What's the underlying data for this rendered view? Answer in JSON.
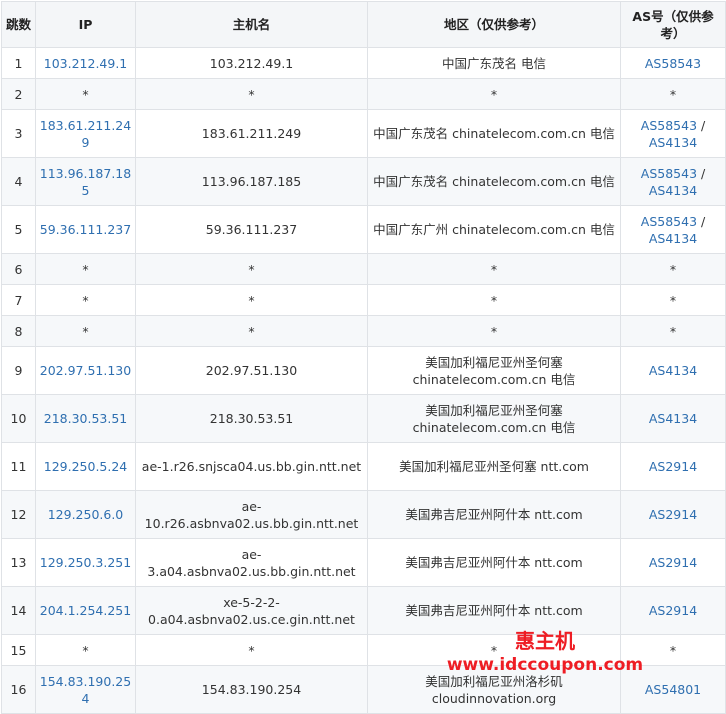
{
  "headers": {
    "hop": "跳数",
    "ip": "IP",
    "hostname": "主机名",
    "region": "地区（仅供参考）",
    "as": "AS号（仅供参考）"
  },
  "rows": [
    {
      "hop": "1",
      "ip": "103.212.49.1",
      "host": "103.212.49.1",
      "region": "中国广东茂名 电信",
      "as": "AS58543"
    },
    {
      "hop": "2",
      "ip": "*",
      "host": "*",
      "region": "*",
      "as": "*"
    },
    {
      "hop": "3",
      "ip": "183.61.211.249",
      "host": "183.61.211.249",
      "region": "中国广东茂名 chinatelecom.com.cn 电信",
      "as": "AS58543",
      "as_sep": " / ",
      "as2": "AS4134"
    },
    {
      "hop": "4",
      "ip": "113.96.187.185",
      "host": "113.96.187.185",
      "region": "中国广东茂名 chinatelecom.com.cn 电信",
      "as": "AS58543",
      "as_sep": " / ",
      "as2": "AS4134"
    },
    {
      "hop": "5",
      "ip": "59.36.111.237",
      "host": "59.36.111.237",
      "region": "中国广东广州 chinatelecom.com.cn 电信",
      "as": "AS58543",
      "as_sep": " / ",
      "as2": "AS4134"
    },
    {
      "hop": "6",
      "ip": "*",
      "host": "*",
      "region": "*",
      "as": "*"
    },
    {
      "hop": "7",
      "ip": "*",
      "host": "*",
      "region": "*",
      "as": "*"
    },
    {
      "hop": "8",
      "ip": "*",
      "host": "*",
      "region": "*",
      "as": "*"
    },
    {
      "hop": "9",
      "ip": "202.97.51.130",
      "host": "202.97.51.130",
      "region": "美国加利福尼亚州圣何塞 chinatelecom.com.cn 电信",
      "as": "AS4134"
    },
    {
      "hop": "10",
      "ip": "218.30.53.51",
      "host": "218.30.53.51",
      "region": "美国加利福尼亚州圣何塞 chinatelecom.com.cn 电信",
      "as": "AS4134"
    },
    {
      "hop": "11",
      "ip": "129.250.5.24",
      "host": "ae-1.r26.snjsca04.us.bb.gin.ntt.net",
      "region": "美国加利福尼亚州圣何塞 ntt.com",
      "as": "AS2914"
    },
    {
      "hop": "12",
      "ip": "129.250.6.0",
      "host": "ae-10.r26.asbnva02.us.bb.gin.ntt.net",
      "region": "美国弗吉尼亚州阿什本 ntt.com",
      "as": "AS2914"
    },
    {
      "hop": "13",
      "ip": "129.250.3.251",
      "host": "ae-3.a04.asbnva02.us.bb.gin.ntt.net",
      "region": "美国弗吉尼亚州阿什本 ntt.com",
      "as": "AS2914"
    },
    {
      "hop": "14",
      "ip": "204.1.254.251",
      "host": "xe-5-2-2-0.a04.asbnva02.us.ce.gin.ntt.net",
      "region": "美国弗吉尼亚州阿什本 ntt.com",
      "as": "AS2914"
    },
    {
      "hop": "15",
      "ip": "*",
      "host": "*",
      "region": "*",
      "as": "*"
    },
    {
      "hop": "16",
      "ip": "154.83.190.254",
      "host": "154.83.190.254",
      "region": "美国加利福尼亚州洛杉矶 cloudinnovation.org",
      "as": "AS54801"
    }
  ],
  "watermark": {
    "title": "惠主机",
    "url": "www.idccoupon.com"
  },
  "colors": {
    "link": "#2f6fb0",
    "header_bg": "#f4f6f8",
    "stripe_bg": "#f6f8fa",
    "border": "#dfe2e6",
    "watermark": "#ee1d24"
  }
}
